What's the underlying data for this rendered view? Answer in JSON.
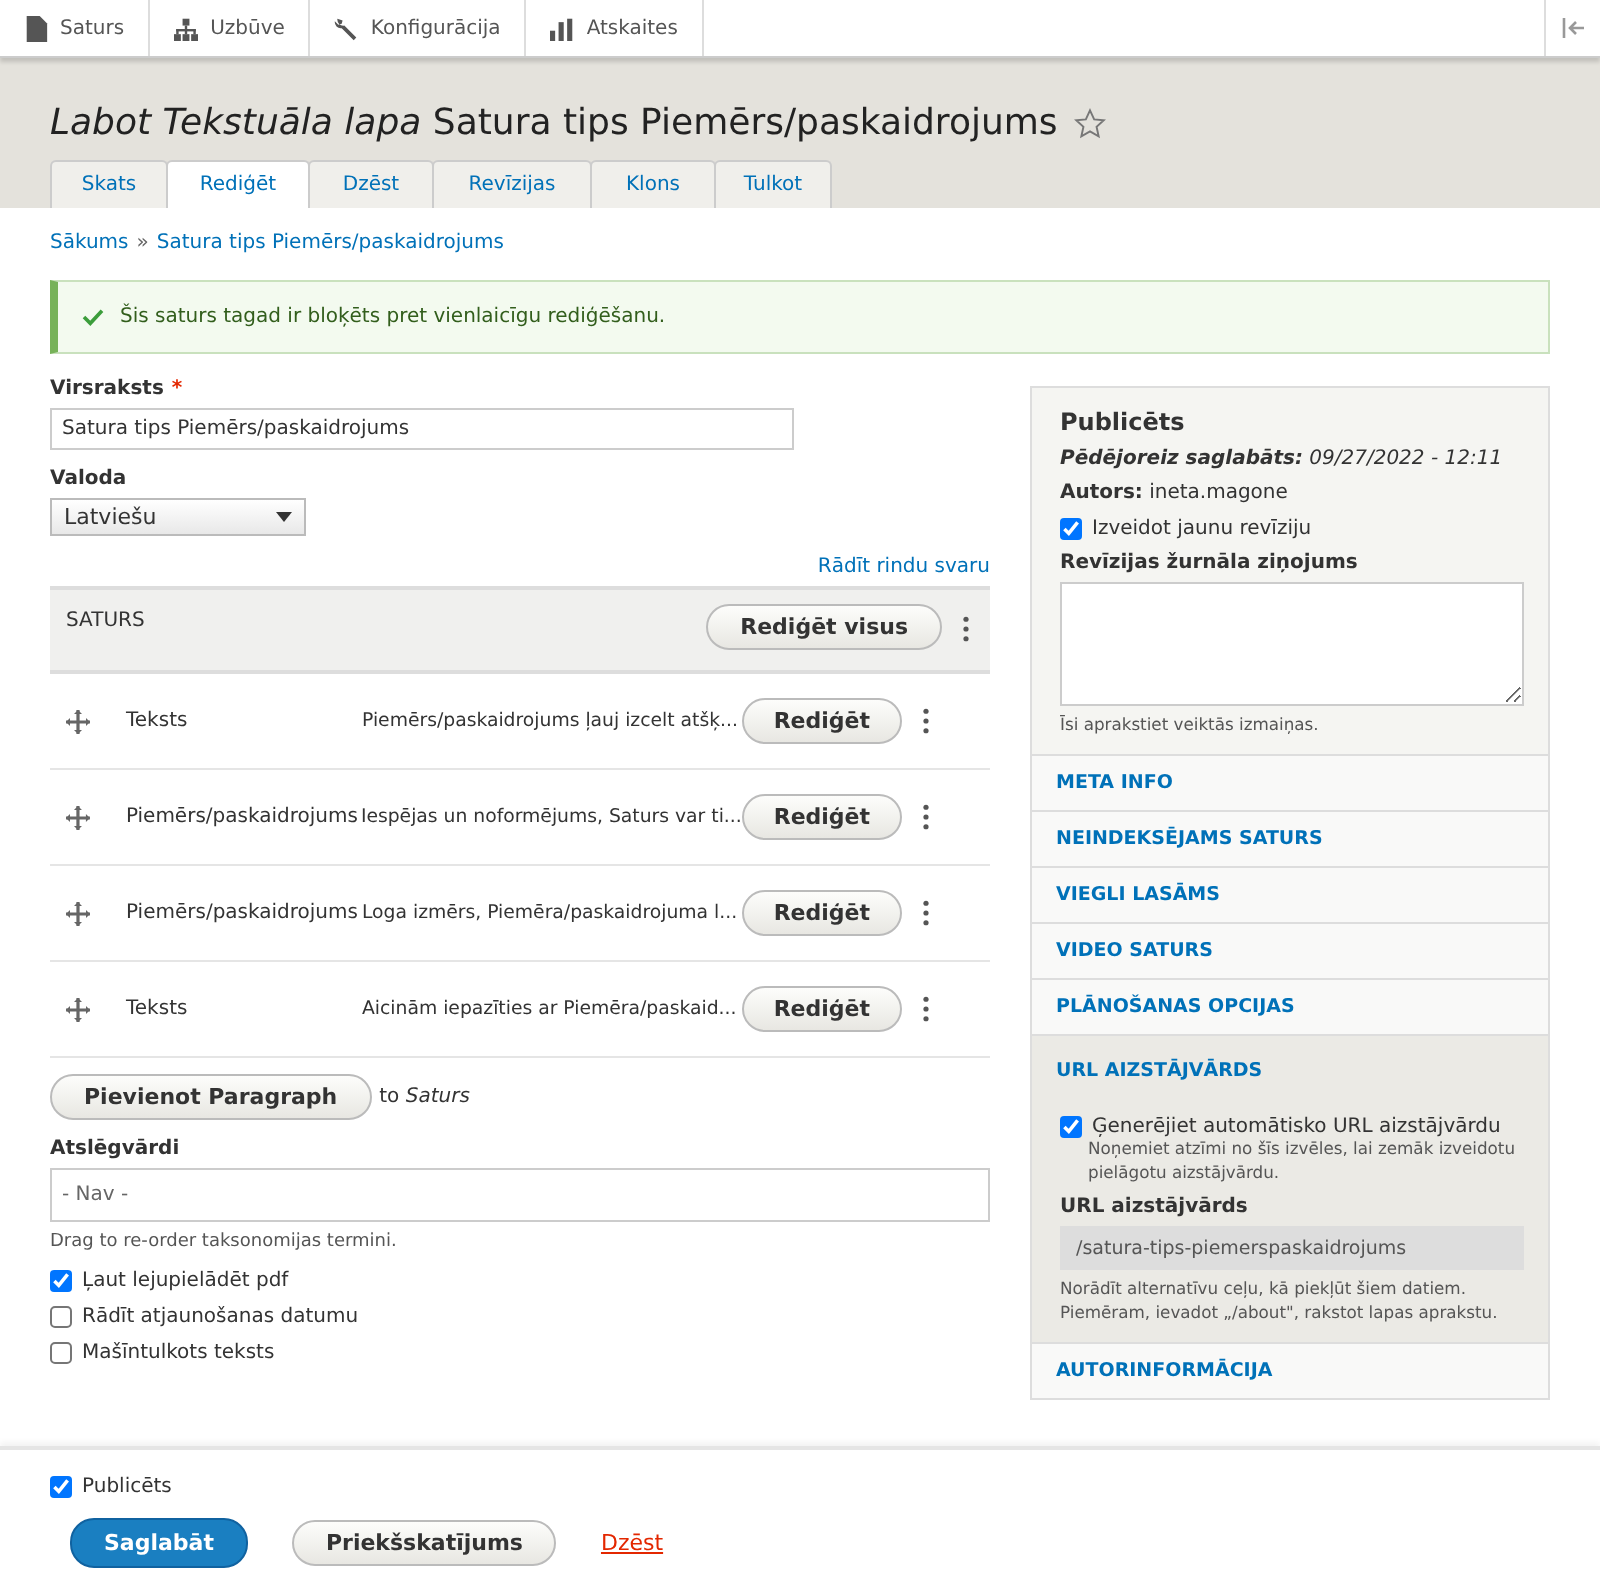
{
  "toolbar": {
    "items": [
      {
        "label": "Saturs"
      },
      {
        "label": "Uzbūve"
      },
      {
        "label": "Konfigurācija"
      },
      {
        "label": "Atskaites"
      }
    ]
  },
  "header": {
    "title_prefix": "Labot Tekstuāla lapa",
    "title": "Satura tips Piemērs/paskaidrojums",
    "starred": false
  },
  "tabs": [
    {
      "label": "Skats",
      "selected": false
    },
    {
      "label": "Rediģēt",
      "selected": true
    },
    {
      "label": "Dzēst",
      "selected": false
    },
    {
      "label": "Revīzijas",
      "selected": false
    },
    {
      "label": "Klons",
      "selected": false
    },
    {
      "label": "Tulkot",
      "selected": false
    }
  ],
  "breadcrumb": [
    "Sākums",
    "Satura tips Piemērs/paskaidrojums"
  ],
  "breadcrumb_separator": "»",
  "message": {
    "text": "Šis saturs tagad ir bloķēts pret vienlaicīgu rediģēšanu."
  },
  "form": {
    "title_label": "Virsraksts",
    "title_required_mark": "*",
    "title_value": "Satura tips Piemērs/paskaidrojums",
    "language_label": "Valoda",
    "language_value": "Latviešu",
    "row_weights_link": "Rādīt rindu svaru",
    "paragraphs": {
      "heading": "SATURS",
      "edit_all": "Rediģēt visus",
      "rows": [
        {
          "type": "Teksts",
          "summary": "Piemērs/paskaidrojums ļauj izcelt atšķ...",
          "button": "Rediģēt"
        },
        {
          "type": "Piemērs/paskaidrojums",
          "summary": "Iespējas un noformējums, Saturs var ti...",
          "button": "Rediģēt"
        },
        {
          "type": "Piemērs/paskaidrojums",
          "summary": "Loga izmērs, Piemēra/paskaidrojuma l...",
          "button": "Rediģēt"
        },
        {
          "type": "Teksts",
          "summary": "Aicinām iepazīties ar Piemēra/paskaid...",
          "button": "Rediģēt"
        }
      ],
      "add_button": "Pievienot Paragraph",
      "add_to": "to",
      "add_target": "Saturs"
    },
    "keywords_label": "Atslēgvārdi",
    "keywords_placeholder": "- Nav -",
    "keywords_help": "Drag to re-order taksonomijas termini.",
    "checkboxes": [
      {
        "label": "Ļaut lejupielādēt pdf",
        "checked": true
      },
      {
        "label": "Rādīt atjaunošanas datumu",
        "checked": false
      },
      {
        "label": "Mašīntulkots teksts",
        "checked": false
      }
    ]
  },
  "sidebar": {
    "status": "Publicēts",
    "last_saved_label": "Pēdējoreiz saglabāts:",
    "last_saved": "09/27/2022 - 12:11",
    "author_label": "Autors:",
    "author": "ineta.magone",
    "new_revision": {
      "label": "Izveidot jaunu revīziju",
      "checked": true
    },
    "log_label": "Revīzijas žurnāla ziņojums",
    "log_help": "Īsi aprakstiet veiktās izmaiņas.",
    "sections": [
      {
        "title": "META INFO",
        "expanded": false
      },
      {
        "title": "NEINDEKSĒJAMS SATURS",
        "expanded": false
      },
      {
        "title": "VIEGLI LASĀMS",
        "expanded": false
      },
      {
        "title": "VIDEO SATURS",
        "expanded": false
      },
      {
        "title": "PLĀNOŠANAS OPCIJAS",
        "expanded": false
      },
      {
        "title": "URL AIZSTĀJVĀRDS",
        "expanded": true,
        "auto_label": "Ģenerējiet automātisko URL aizstājvārdu",
        "auto_checked": true,
        "auto_help": "Noņemiet atzīmi no šīs izvēles, lai zemāk izveidotu pielāgotu aizstājvārdu.",
        "alias_label": "URL aizstājvārds",
        "alias_value": "/satura-tips-piemerspaskaidrojums",
        "alias_help": "Norādīt alternatīvu ceļu, kā piekļūt šiem datiem. Piemēram, ievadot „/about\", rakstot lapas aprakstu."
      },
      {
        "title": "AUTORINFORMĀCIJA",
        "expanded": false
      }
    ]
  },
  "footer": {
    "published": {
      "label": "Publicēts",
      "checked": true
    },
    "save": "Saglabāt",
    "preview": "Priekšskatījums",
    "delete": "Dzēst"
  }
}
